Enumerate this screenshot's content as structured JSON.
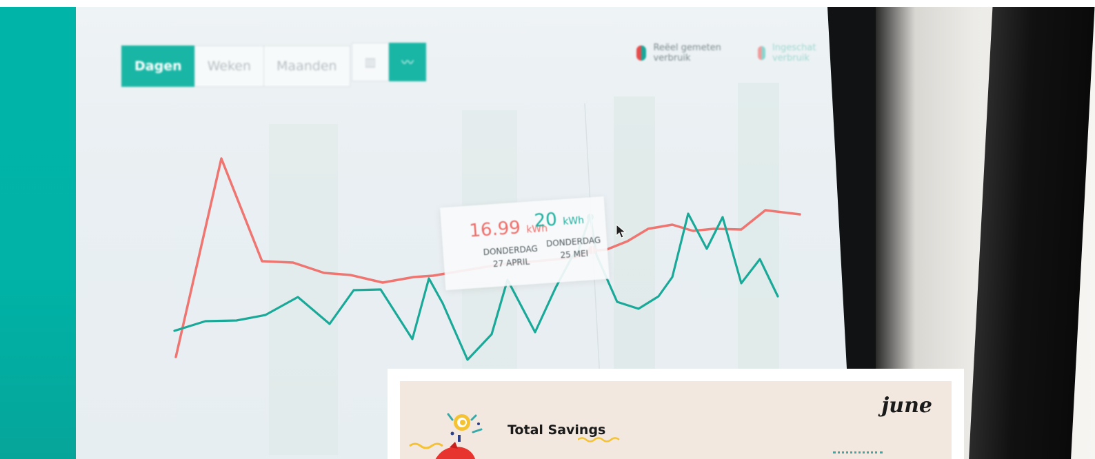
{
  "screen": {
    "toolbar": {
      "tabs": [
        {
          "label": "Dagen",
          "active": true
        },
        {
          "label": "Weken",
          "active": false
        },
        {
          "label": "Maanden",
          "active": false
        }
      ],
      "view_toggle": [
        {
          "icon": "bar-chart-icon",
          "active": false
        },
        {
          "icon": "line-chart-icon",
          "active": true
        }
      ]
    },
    "legend": [
      {
        "label": "Reëel gemeten verbruik",
        "color": "#e74c4c"
      },
      {
        "label": "Ingeschat verbruik",
        "color": "#17a89a"
      }
    ],
    "tooltip": {
      "value_a": "16.99",
      "unit_a": "kWh",
      "day_a": "DONDERDAG",
      "date_a": "27 APRIL",
      "value_b": "20",
      "unit_b": "kWh",
      "day_b": "DONDERDAG",
      "date_b": "25 MEI"
    },
    "colors": {
      "accent": "#19b6a5",
      "series_red": "#ee6f6b",
      "series_teal": "#1db0a0"
    }
  },
  "card": {
    "title": "Total Savings",
    "brand": "june",
    "background": "#f2e8df"
  }
}
